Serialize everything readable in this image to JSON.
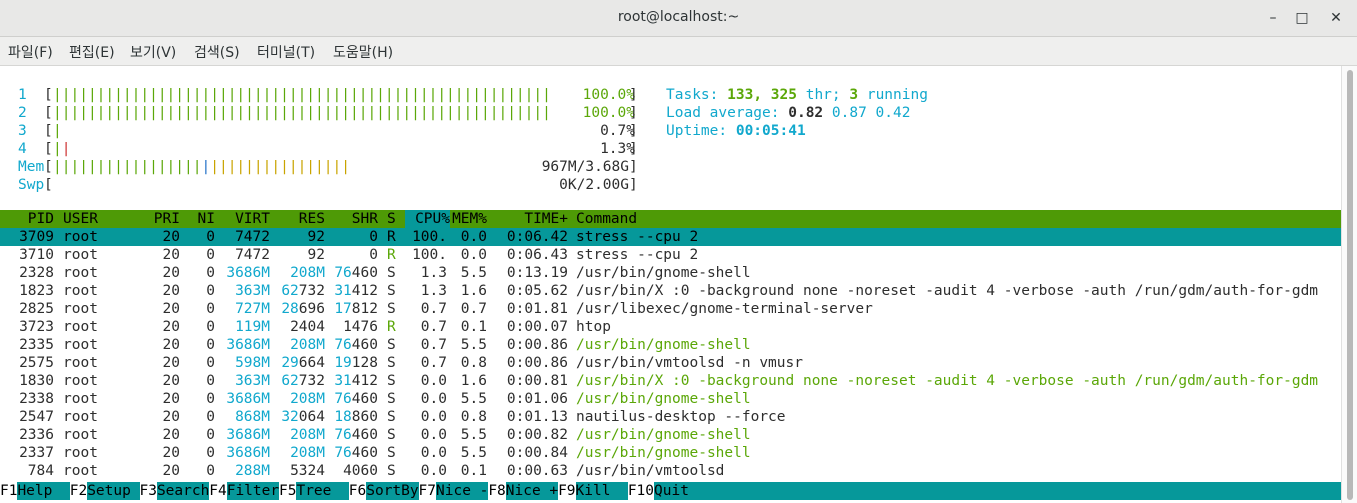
{
  "window": {
    "title": "root@localhost:~",
    "minimize": "–",
    "maximize": "□",
    "close": "✕"
  },
  "menu": [
    "파일(F)",
    "편집(E)",
    "보기(V)",
    "검색(S)",
    "터미널(T)",
    "도움말(H)"
  ],
  "meters": {
    "cpu": [
      {
        "num": "1",
        "pct": "100.0%",
        "ticks": 57
      },
      {
        "num": "2",
        "pct": "100.0%",
        "ticks": 57
      },
      {
        "num": "3",
        "pct": "0.7%",
        "ticks": 1
      },
      {
        "num": "4",
        "pct": "1.3%",
        "ticks": 2
      }
    ],
    "mem_label": "Mem",
    "mem_value": "967M/3.68G",
    "swp_label": "Swp",
    "swp_value": "0K/2.00G"
  },
  "summary": {
    "tasks_label": "Tasks:",
    "tasks": "133,",
    "thr": "325",
    "thr_label": "thr;",
    "running": "3",
    "running_label": "running",
    "load_label": "Load average:",
    "load1": "0.82",
    "load5": "0.87",
    "load15": "0.42",
    "uptime_label": "Uptime:",
    "uptime": "00:05:41"
  },
  "columns": [
    "PID",
    "USER",
    "PRI",
    "NI",
    "VIRT",
    "RES",
    "SHR",
    "S",
    "CPU%",
    "MEM%",
    "TIME+",
    "Command"
  ],
  "processes": [
    {
      "pid": "3709",
      "user": "root",
      "pri": "20",
      "ni": "0",
      "virt": "7472",
      "res": "92",
      "shr": "0",
      "s": "R",
      "cpu": "100.",
      "mem": "0.0",
      "time": "0:06.42",
      "cmd": "stress --cpu 2",
      "sel": true
    },
    {
      "pid": "3710",
      "user": "root",
      "pri": "20",
      "ni": "0",
      "virt": "7472",
      "res": "92",
      "shr": "0",
      "s": "R",
      "cpu": "100.",
      "mem": "0.0",
      "time": "0:06.43",
      "cmd": "stress --cpu 2"
    },
    {
      "pid": "2328",
      "user": "root",
      "pri": "20",
      "ni": "0",
      "virt": "3686M",
      "res": "208M",
      "shr": "76460",
      "s": "S",
      "cpu": "1.3",
      "mem": "5.5",
      "time": "0:13.19",
      "cmd": "/usr/bin/gnome-shell"
    },
    {
      "pid": "1823",
      "user": "root",
      "pri": "20",
      "ni": "0",
      "virt": "363M",
      "res": "62732",
      "shr": "31412",
      "s": "S",
      "cpu": "1.3",
      "mem": "1.6",
      "time": "0:05.62",
      "cmd": "/usr/bin/X :0 -background none -noreset -audit 4 -verbose -auth /run/gdm/auth-for-gdm"
    },
    {
      "pid": "2825",
      "user": "root",
      "pri": "20",
      "ni": "0",
      "virt": "727M",
      "res": "28696",
      "shr": "17812",
      "s": "S",
      "cpu": "0.7",
      "mem": "0.7",
      "time": "0:01.81",
      "cmd": "/usr/libexec/gnome-terminal-server"
    },
    {
      "pid": "3723",
      "user": "root",
      "pri": "20",
      "ni": "0",
      "virt": "119M",
      "res": "2404",
      "shr": "1476",
      "s": "R",
      "cpu": "0.7",
      "mem": "0.1",
      "time": "0:00.07",
      "cmd": "htop"
    },
    {
      "pid": "2335",
      "user": "root",
      "pri": "20",
      "ni": "0",
      "virt": "3686M",
      "res": "208M",
      "shr": "76460",
      "s": "S",
      "cpu": "0.7",
      "mem": "5.5",
      "time": "0:00.86",
      "cmd": "/usr/bin/gnome-shell",
      "thread": true
    },
    {
      "pid": "2575",
      "user": "root",
      "pri": "20",
      "ni": "0",
      "virt": "598M",
      "res": "29664",
      "shr": "19128",
      "s": "S",
      "cpu": "0.7",
      "mem": "0.8",
      "time": "0:00.86",
      "cmd": "/usr/bin/vmtoolsd -n vmusr"
    },
    {
      "pid": "1830",
      "user": "root",
      "pri": "20",
      "ni": "0",
      "virt": "363M",
      "res": "62732",
      "shr": "31412",
      "s": "S",
      "cpu": "0.0",
      "mem": "1.6",
      "time": "0:00.81",
      "cmd": "/usr/bin/X :0 -background none -noreset -audit 4 -verbose -auth /run/gdm/auth-for-gdm",
      "thread": true
    },
    {
      "pid": "2338",
      "user": "root",
      "pri": "20",
      "ni": "0",
      "virt": "3686M",
      "res": "208M",
      "shr": "76460",
      "s": "S",
      "cpu": "0.0",
      "mem": "5.5",
      "time": "0:01.06",
      "cmd": "/usr/bin/gnome-shell",
      "thread": true
    },
    {
      "pid": "2547",
      "user": "root",
      "pri": "20",
      "ni": "0",
      "virt": "868M",
      "res": "32064",
      "shr": "18860",
      "s": "S",
      "cpu": "0.0",
      "mem": "0.8",
      "time": "0:01.13",
      "cmd": "nautilus-desktop --force"
    },
    {
      "pid": "2336",
      "user": "root",
      "pri": "20",
      "ni": "0",
      "virt": "3686M",
      "res": "208M",
      "shr": "76460",
      "s": "S",
      "cpu": "0.0",
      "mem": "5.5",
      "time": "0:00.82",
      "cmd": "/usr/bin/gnome-shell",
      "thread": true
    },
    {
      "pid": "2337",
      "user": "root",
      "pri": "20",
      "ni": "0",
      "virt": "3686M",
      "res": "208M",
      "shr": "76460",
      "s": "S",
      "cpu": "0.0",
      "mem": "5.5",
      "time": "0:00.84",
      "cmd": "/usr/bin/gnome-shell",
      "thread": true
    },
    {
      "pid": "784",
      "user": "root",
      "pri": "20",
      "ni": "0",
      "virt": "288M",
      "res": "5324",
      "shr": "4060",
      "s": "S",
      "cpu": "0.0",
      "mem": "0.1",
      "time": "0:00.63",
      "cmd": "/usr/bin/vmtoolsd"
    }
  ],
  "fkeys": [
    {
      "key": "F1",
      "label": "Help  "
    },
    {
      "key": "F2",
      "label": "Setup "
    },
    {
      "key": "F3",
      "label": "Search"
    },
    {
      "key": "F4",
      "label": "Filter"
    },
    {
      "key": "F5",
      "label": "Tree  "
    },
    {
      "key": "F6",
      "label": "SortBy"
    },
    {
      "key": "F7",
      "label": "Nice -"
    },
    {
      "key": "F8",
      "label": "Nice +"
    },
    {
      "key": "F9",
      "label": "Kill  "
    },
    {
      "key": "F10",
      "label": "Quit"
    }
  ],
  "colors": {
    "header_bg": "#4e9a06",
    "select_bg": "#06989a",
    "cyan": "#11a8cd",
    "green": "#5ba708"
  }
}
